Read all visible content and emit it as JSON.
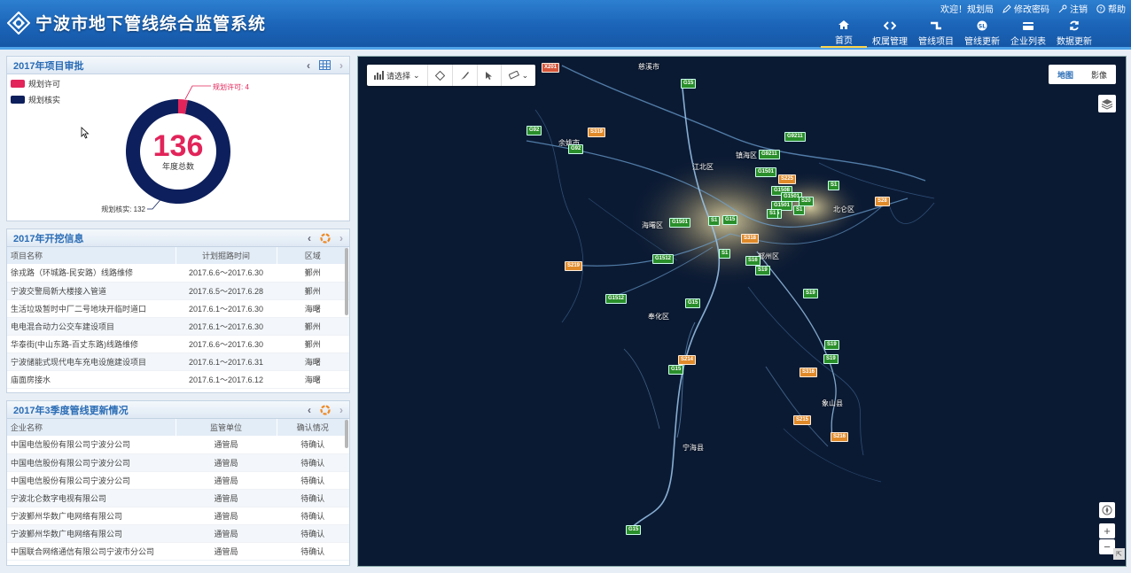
{
  "app": {
    "title": "宁波市地下管线综合监管系统"
  },
  "top_links": {
    "welcome": "欢迎！规划局",
    "change_password": "修改密码",
    "logout": "注销",
    "help": "帮助"
  },
  "nav": [
    {
      "label": "首页",
      "icon": "home-icon"
    },
    {
      "label": "权属管理",
      "icon": "code-icon"
    },
    {
      "label": "管线项目",
      "icon": "pipe-icon"
    },
    {
      "label": "管线更新",
      "icon": "update-badge-icon"
    },
    {
      "label": "企业列表",
      "icon": "card-icon"
    },
    {
      "label": "数据更新",
      "icon": "refresh-icon"
    }
  ],
  "approval_panel": {
    "title": "2017年项目审批",
    "legend": [
      {
        "label": "规划许可",
        "color": "#e2245a"
      },
      {
        "label": "规划核实",
        "color": "#0d1f5c"
      }
    ],
    "chart_data": {
      "type": "pie",
      "donut": true,
      "categories": [
        "规划许可",
        "规划核实"
      ],
      "values": [
        4,
        132
      ],
      "colors": [
        "#e2245a",
        "#0d1f5c"
      ],
      "center_value": "136",
      "center_label": "年度总数",
      "slice_labels": [
        "规划许可: 4",
        "规划核实: 132"
      ]
    }
  },
  "excavation_panel": {
    "title": "2017年开挖信息",
    "headers": [
      "项目名称",
      "计划掘路时间",
      "区域"
    ],
    "rows": [
      [
        "徐戎路（环城路-民安路）线路维修",
        "2017.6.6～2017.6.30",
        "鄞州"
      ],
      [
        "宁波交警局新大楼接入管道",
        "2017.6.5～2017.6.28",
        "鄞州"
      ],
      [
        "生活垃圾暂时中厂二号地块开临时道口",
        "2017.6.1～2017.6.30",
        "海曙"
      ],
      [
        "电电混合动力公交车建设项目",
        "2017.6.1～2017.6.30",
        "鄞州"
      ],
      [
        "华泰街(中山东路-百丈东路)线路维修",
        "2017.6.6～2017.6.30",
        "鄞州"
      ],
      [
        "宁波储能式现代电车充电设施建设项目",
        "2017.6.1～2017.6.31",
        "海曙"
      ],
      [
        "庙面房接水",
        "2017.6.1～2017.6.12",
        "海曙"
      ]
    ]
  },
  "pipeline_update_panel": {
    "title": "2017年3季度管线更新情况",
    "headers": [
      "企业名称",
      "监管单位",
      "确认情况"
    ],
    "rows": [
      [
        "中国电信股份有限公司宁波分公司",
        "通管局",
        "待确认"
      ],
      [
        "中国电信股份有限公司宁波分公司",
        "通管局",
        "待确认"
      ],
      [
        "中国电信股份有限公司宁波分公司",
        "通管局",
        "待确认"
      ],
      [
        "宁波北仑数字电视有限公司",
        "通管局",
        "待确认"
      ],
      [
        "宁波鄞州华数广电网络有限公司",
        "通管局",
        "待确认"
      ],
      [
        "宁波鄞州华数广电网络有限公司",
        "通管局",
        "待确认"
      ],
      [
        "中国联合网络通信有限公司宁波市分公司",
        "通管局",
        "待确认"
      ]
    ]
  },
  "map": {
    "toolbar": {
      "select_label": "请选择"
    },
    "switch": {
      "map": "地图",
      "image": "影像"
    },
    "zoom_in": "+",
    "zoom_out": "−",
    "places": [
      {
        "name": "慈溪市"
      },
      {
        "name": "余姚市"
      },
      {
        "name": "江北区"
      },
      {
        "name": "镇海区"
      },
      {
        "name": "北仑区"
      },
      {
        "name": "海曙区"
      },
      {
        "name": "鄞州区"
      },
      {
        "name": "奉化区"
      },
      {
        "name": "象山县"
      },
      {
        "name": "宁海县"
      }
    ],
    "shields": [
      {
        "text": "X201",
        "kind": "red"
      },
      {
        "text": "G15",
        "kind": "green"
      },
      {
        "text": "G92",
        "kind": "green"
      },
      {
        "text": "S319",
        "kind": "orange"
      },
      {
        "text": "G92",
        "kind": "green"
      },
      {
        "text": "G9211",
        "kind": "green"
      },
      {
        "text": "G9211",
        "kind": "green"
      },
      {
        "text": "G1501",
        "kind": "green"
      },
      {
        "text": "S225",
        "kind": "orange"
      },
      {
        "text": "G1508",
        "kind": "green"
      },
      {
        "text": "G1501",
        "kind": "green"
      },
      {
        "text": "S1",
        "kind": "green"
      },
      {
        "text": "S20",
        "kind": "green"
      },
      {
        "text": "G1501",
        "kind": "green"
      },
      {
        "text": "G15",
        "kind": "green"
      },
      {
        "text": "S1",
        "kind": "green"
      },
      {
        "text": "S1",
        "kind": "green"
      },
      {
        "text": "G15",
        "kind": "green"
      },
      {
        "text": "G1501",
        "kind": "green"
      },
      {
        "text": "S1",
        "kind": "green"
      },
      {
        "text": "S318",
        "kind": "orange"
      },
      {
        "text": "G1512",
        "kind": "green"
      },
      {
        "text": "S1",
        "kind": "green"
      },
      {
        "text": "S16",
        "kind": "green"
      },
      {
        "text": "S19",
        "kind": "green"
      },
      {
        "text": "S219",
        "kind": "orange"
      },
      {
        "text": "G1512",
        "kind": "green"
      },
      {
        "text": "G15",
        "kind": "green"
      },
      {
        "text": "S19",
        "kind": "green"
      },
      {
        "text": "S19",
        "kind": "green"
      },
      {
        "text": "S214",
        "kind": "orange"
      },
      {
        "text": "G15",
        "kind": "green"
      },
      {
        "text": "S19",
        "kind": "green"
      },
      {
        "text": "S316",
        "kind": "orange"
      },
      {
        "text": "S215",
        "kind": "orange"
      },
      {
        "text": "S216",
        "kind": "orange"
      },
      {
        "text": "G15",
        "kind": "green"
      },
      {
        "text": "S28",
        "kind": "orange"
      }
    ]
  }
}
